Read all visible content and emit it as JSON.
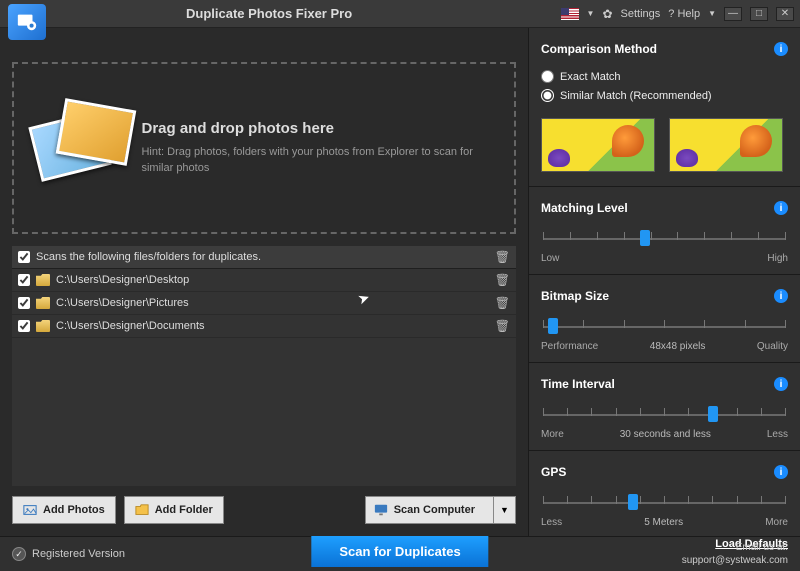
{
  "titlebar": {
    "app_title": "Duplicate Photos Fixer Pro",
    "settings_label": "Settings",
    "help_label": "? Help",
    "minimize": "—",
    "maximize": "□",
    "close": "✕"
  },
  "drop": {
    "heading": "Drag and drop photos here",
    "hint": "Hint: Drag photos, folders with your photos from Explorer to scan for similar photos"
  },
  "filelist": {
    "header": "Scans the following files/folders for duplicates.",
    "rows": [
      "C:\\Users\\Designer\\Desktop",
      "C:\\Users\\Designer\\Pictures",
      "C:\\Users\\Designer\\Documents"
    ]
  },
  "buttons": {
    "add_photos": "Add Photos",
    "add_folder": "Add Folder",
    "scan_computer": "Scan Computer"
  },
  "comparison": {
    "title": "Comparison Method",
    "exact": "Exact Match",
    "similar": "Similar Match (Recommended)"
  },
  "sliders": {
    "matching": {
      "title": "Matching Level",
      "low": "Low",
      "high": "High"
    },
    "bitmap": {
      "title": "Bitmap Size",
      "low": "Performance",
      "mid": "48x48 pixels",
      "high": "Quality"
    },
    "time": {
      "title": "Time Interval",
      "low": "More",
      "mid": "30 seconds and less",
      "high": "Less"
    },
    "gps": {
      "title": "GPS",
      "low": "Less",
      "mid": "5 Meters",
      "high": "More"
    }
  },
  "load_defaults": "Load Defaults",
  "bottom": {
    "registered": "Registered Version",
    "scan": "Scan for Duplicates",
    "email_label": "Email us at:",
    "email": "support@systweak.com"
  }
}
